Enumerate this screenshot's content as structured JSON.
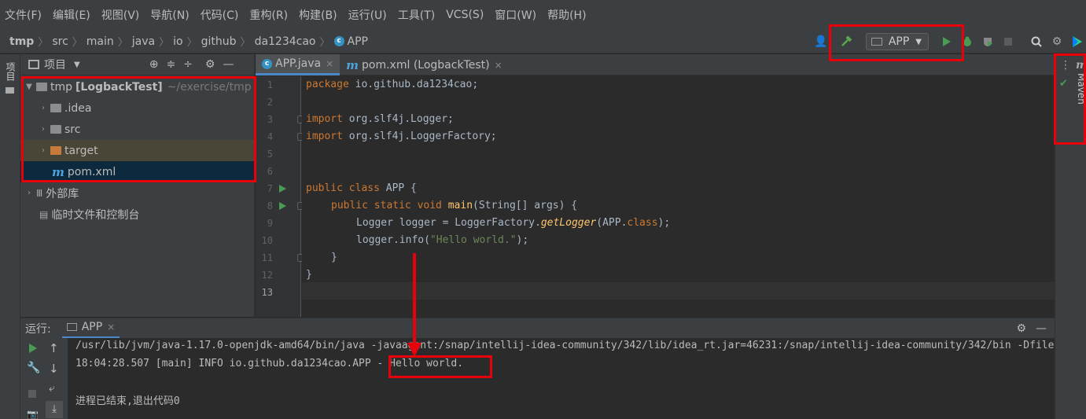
{
  "menu": [
    "文件(F)",
    "编辑(E)",
    "视图(V)",
    "导航(N)",
    "代码(C)",
    "重构(R)",
    "构建(B)",
    "运行(U)",
    "工具(T)",
    "VCS(S)",
    "窗口(W)",
    "帮助(H)"
  ],
  "breadcrumb": [
    "tmp",
    "src",
    "main",
    "java",
    "io",
    "github",
    "da1234cao",
    "APP"
  ],
  "toolbar": {
    "run_config": "APP"
  },
  "left_stripe": {
    "project_label": "项目"
  },
  "project_panel": {
    "title": "项目",
    "root": {
      "name": "tmp",
      "module": "[LogbackTest]",
      "path": "~/exercise/tmp"
    },
    "items": [
      ".idea",
      "src",
      "target",
      "pom.xml"
    ],
    "external": "外部库",
    "scratch": "临时文件和控制台"
  },
  "editor_tabs": [
    "APP.java",
    "pom.xml (LogbackTest)"
  ],
  "code": {
    "line_numbers": [
      "1",
      "2",
      "3",
      "4",
      "5",
      "6",
      "7",
      "8",
      "9",
      "10",
      "11",
      "12",
      "13"
    ],
    "l1_kw": "package",
    "l1_rest": " io.github.da1234cao;",
    "l3_kw": "import",
    "l3_rest": " org.slf4j.Logger;",
    "l4_kw": "import",
    "l4_rest": " org.slf4j.LoggerFactory;",
    "l7_kw": "public class",
    "l7_rest": " APP {",
    "l8_kw": "public static void",
    "l8_fn": "main",
    "l8_rest": "(String[] args) {",
    "l9_a": "Logger logger = LoggerFactory.",
    "l9_it": "getLogger",
    "l9_b": "(APP.",
    "l9_kw": "class",
    "l9_c": ");",
    "l10_a": "logger.info(",
    "l10_str": "\"Hello world.\"",
    "l10_b": ");",
    "l11": "}",
    "l12": "}"
  },
  "right_stripe": {
    "maven_label": "Maven"
  },
  "run_panel": {
    "label": "运行:",
    "tab": "APP",
    "lines": [
      "/usr/lib/jvm/java-1.17.0-openjdk-amd64/bin/java -javaagent:/snap/intellij-idea-community/342/lib/idea_rt.jar=46231:/snap/intellij-idea-community/342/bin -Dfile",
      "18:04:28.507 [main] INFO io.github.da1234cao.APP - Hello world.",
      "",
      "进程已结束,退出代码0"
    ]
  },
  "colors": {
    "highlight": "#e8000a",
    "run_green": "#499c54",
    "accent_blue": "#4a88c7"
  }
}
